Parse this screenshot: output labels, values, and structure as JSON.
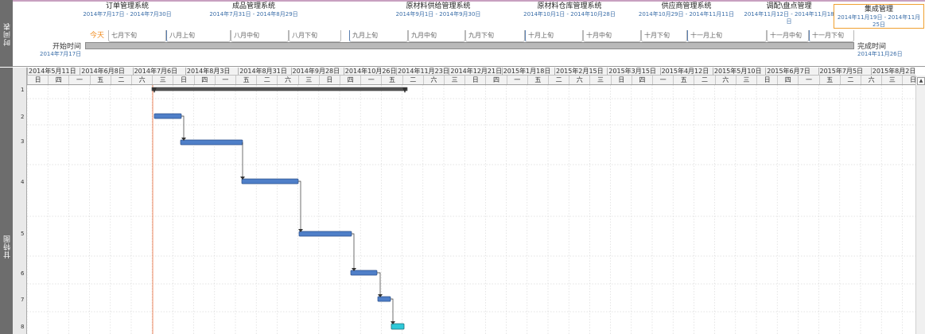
{
  "timeline": {
    "sidebar_label": "时间表",
    "today_label": "今天",
    "start_label": "开始时间",
    "start_date": "2014年7月17日",
    "end_label": "完成时间",
    "end_date": "2014年11月26日",
    "tasks": [
      {
        "title": "订单管理系统",
        "dates": "2014年7月17日 - 2014年7月30日"
      },
      {
        "title": "成品管理系统",
        "dates": "2014年7月31日 - 2014年8月29日"
      },
      {
        "title": "原材料供给管理系统",
        "dates": "2014年9月1日 - 2014年9月30日"
      },
      {
        "title": "原材料仓库管理系统",
        "dates": "2014年10月1日 - 2014年10月28日"
      },
      {
        "title": "供应商管理系统",
        "dates": "2014年10月29日 - 2014年11月11日"
      },
      {
        "title": "调配\\盘点管理",
        "dates": "2014年11月12日 - 2014年11月18日"
      },
      {
        "title": "集成管理",
        "dates": "2014年11月19日 - 2014年11月25日"
      }
    ],
    "periods": [
      "七月下旬",
      "八月上旬",
      "八月中旬",
      "八月下旬",
      "九月上旬",
      "九月中旬",
      "九月下旬",
      "十月上旬",
      "十月中旬",
      "十月下旬",
      "十一月上旬",
      "十一月中旬",
      "十一月下旬"
    ]
  },
  "gantt": {
    "sidebar_label": "甘特图",
    "weeks": [
      "2014年5月11日",
      "2014年6月8日",
      "2014年7月6日",
      "2014年8月3日",
      "2014年8月31日",
      "2014年9月28日",
      "2014年10月26日",
      "2014年11月23日",
      "2014年12月21日",
      "2015年1月18日",
      "2015年2月15日",
      "2015年3月15日",
      "2015年4月12日",
      "2015年5月10日",
      "2015年6月7日",
      "2015年7月5日",
      "2015年8月2日"
    ],
    "day_cycle": [
      "日",
      "四",
      "一",
      "五",
      "二",
      "六",
      "三"
    ],
    "rows": [
      "1",
      "2",
      "3",
      "4",
      "5",
      "6",
      "7",
      "8"
    ],
    "colors": {
      "task_bar": "#4f7fc8",
      "summary_bar": "#6a6a6a",
      "integration_bar": "#2ec8d8",
      "today_line": "#f08a60",
      "connector": "#333333"
    }
  }
}
